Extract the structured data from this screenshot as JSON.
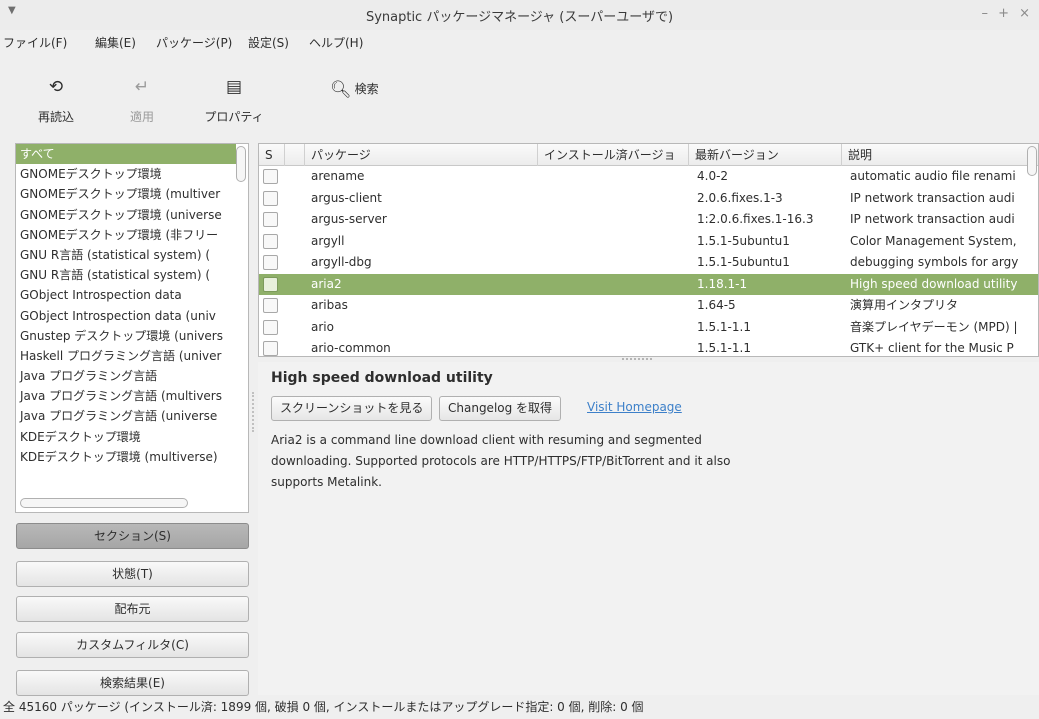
{
  "window": {
    "menu_glyph": "▼",
    "title": "Synaptic パッケージマネージャ (スーパーユーザで)",
    "controls": "– + ×"
  },
  "menubar": {
    "file": "ファイル(F)",
    "edit": "編集(E)",
    "package": "パッケージ(P)",
    "settings": "設定(S)",
    "help": "ヘルプ(H)"
  },
  "toolbar": {
    "reload": "再読込",
    "apply": "適用",
    "properties": "プロパティ",
    "search": "検索"
  },
  "sections": {
    "items": [
      "すべて",
      "GNOMEデスクトップ環境",
      "GNOMEデスクトップ環境 (multiver",
      "GNOMEデスクトップ環境 (universe",
      "GNOMEデスクトップ環境 (非フリー",
      "GNU R言語 (statistical system) (",
      "GNU R言語 (statistical system) (",
      "GObject Introspection data",
      "GObject Introspection data (univ",
      "Gnustep デスクトップ環境 (univers",
      "Haskell プログラミング言語 (univer",
      "Java プログラミング言語",
      "Java プログラミング言語 (multivers",
      "Java プログラミング言語 (universe",
      "KDEデスクトップ環境",
      "KDEデスクトップ環境 (multiverse)"
    ],
    "selected": "すべて"
  },
  "filters": {
    "sections": "セクション(S)",
    "status": "状態(T)",
    "origin": "配布元",
    "custom": "カスタムフィルタ(C)",
    "search_results": "検索結果(E)"
  },
  "packages": {
    "columns": {
      "s": "S",
      "name": "パッケージ",
      "installed": "インストール済バージョ",
      "latest": "最新バージョン",
      "description": "説明"
    },
    "rows": [
      {
        "name": "arename",
        "installed": "",
        "latest": "4.0-2",
        "description": "automatic audio file renami"
      },
      {
        "name": "argus-client",
        "installed": "",
        "latest": "2.0.6.fixes.1-3",
        "description": "IP network transaction audi"
      },
      {
        "name": "argus-server",
        "installed": "",
        "latest": "1:2.0.6.fixes.1-16.3",
        "description": "IP network transaction audi"
      },
      {
        "name": "argyll",
        "installed": "",
        "latest": "1.5.1-5ubuntu1",
        "description": "Color Management System,"
      },
      {
        "name": "argyll-dbg",
        "installed": "",
        "latest": "1.5.1-5ubuntu1",
        "description": "debugging symbols for argy"
      },
      {
        "name": "aria2",
        "installed": "",
        "latest": "1.18.1-1",
        "description": "High speed download utility"
      },
      {
        "name": "aribas",
        "installed": "",
        "latest": "1.64-5",
        "description": "演算用インタプリタ"
      },
      {
        "name": "ario",
        "installed": "",
        "latest": "1.5.1-1.1",
        "description": "音楽プレイヤデーモン (MPD) |"
      },
      {
        "name": "ario-common",
        "installed": "",
        "latest": "1.5.1-1.1",
        "description": "GTK+ client for the Music P"
      }
    ],
    "selected": "aria2"
  },
  "detail": {
    "title": "High speed download utility",
    "screenshot_button": "スクリーンショットを見る",
    "changelog_button": "Changelog を取得",
    "homepage_link": "Visit Homepage",
    "description_lines": [
      "Aria2 is a command line download client with resuming and segmented",
      "downloading. Supported protocols are HTTP/HTTPS/FTP/BitTorrent and it also",
      "supports Metalink."
    ]
  },
  "status": {
    "text": "全 45160 パッケージ (インストール済: 1899 個, 破損 0 個, インストールまたはアップグレード指定: 0 個, 削除: 0 個"
  },
  "colors": {
    "selection": "#8fb069",
    "link": "#3d80c9",
    "window_bg": "#efefef"
  },
  "icons": {
    "reload": "reload-icon",
    "apply": "apply-icon",
    "properties": "properties-icon",
    "search": "search-icon"
  }
}
